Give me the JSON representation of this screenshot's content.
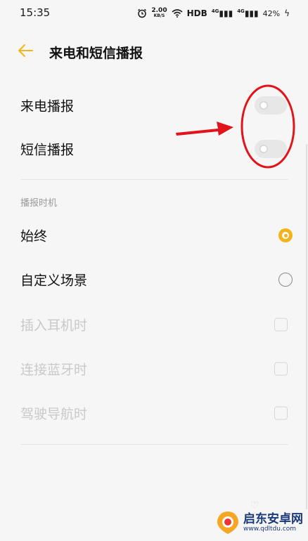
{
  "status_bar": {
    "time": "15:35",
    "alarm_icon": "alarm-clock-icon",
    "speed_value": "2.00",
    "speed_unit": "KB/S",
    "hd_label": "HDB",
    "signal1": "4G",
    "signal2": "4G",
    "battery": "42%"
  },
  "header": {
    "back_icon": "arrow-left-icon",
    "title": "来电和短信播报",
    "accent_color": "#f3b41b"
  },
  "toggles": [
    {
      "label": "来电播报",
      "on": false
    },
    {
      "label": "短信播报",
      "on": false
    }
  ],
  "section": {
    "title": "播报时机"
  },
  "radio_options": [
    {
      "label": "始终",
      "checked": true
    },
    {
      "label": "自定义场景",
      "checked": false
    }
  ],
  "scene_options": [
    {
      "label": "插入耳机时",
      "enabled": false,
      "checked": false
    },
    {
      "label": "连接蓝牙时",
      "enabled": false,
      "checked": false
    },
    {
      "label": "驾驶导航时",
      "enabled": false,
      "checked": false
    }
  ],
  "annotation": {
    "color": "#e0141a"
  },
  "watermark": {
    "title": "启东安卓网",
    "url": "www.qdltdu.com"
  }
}
